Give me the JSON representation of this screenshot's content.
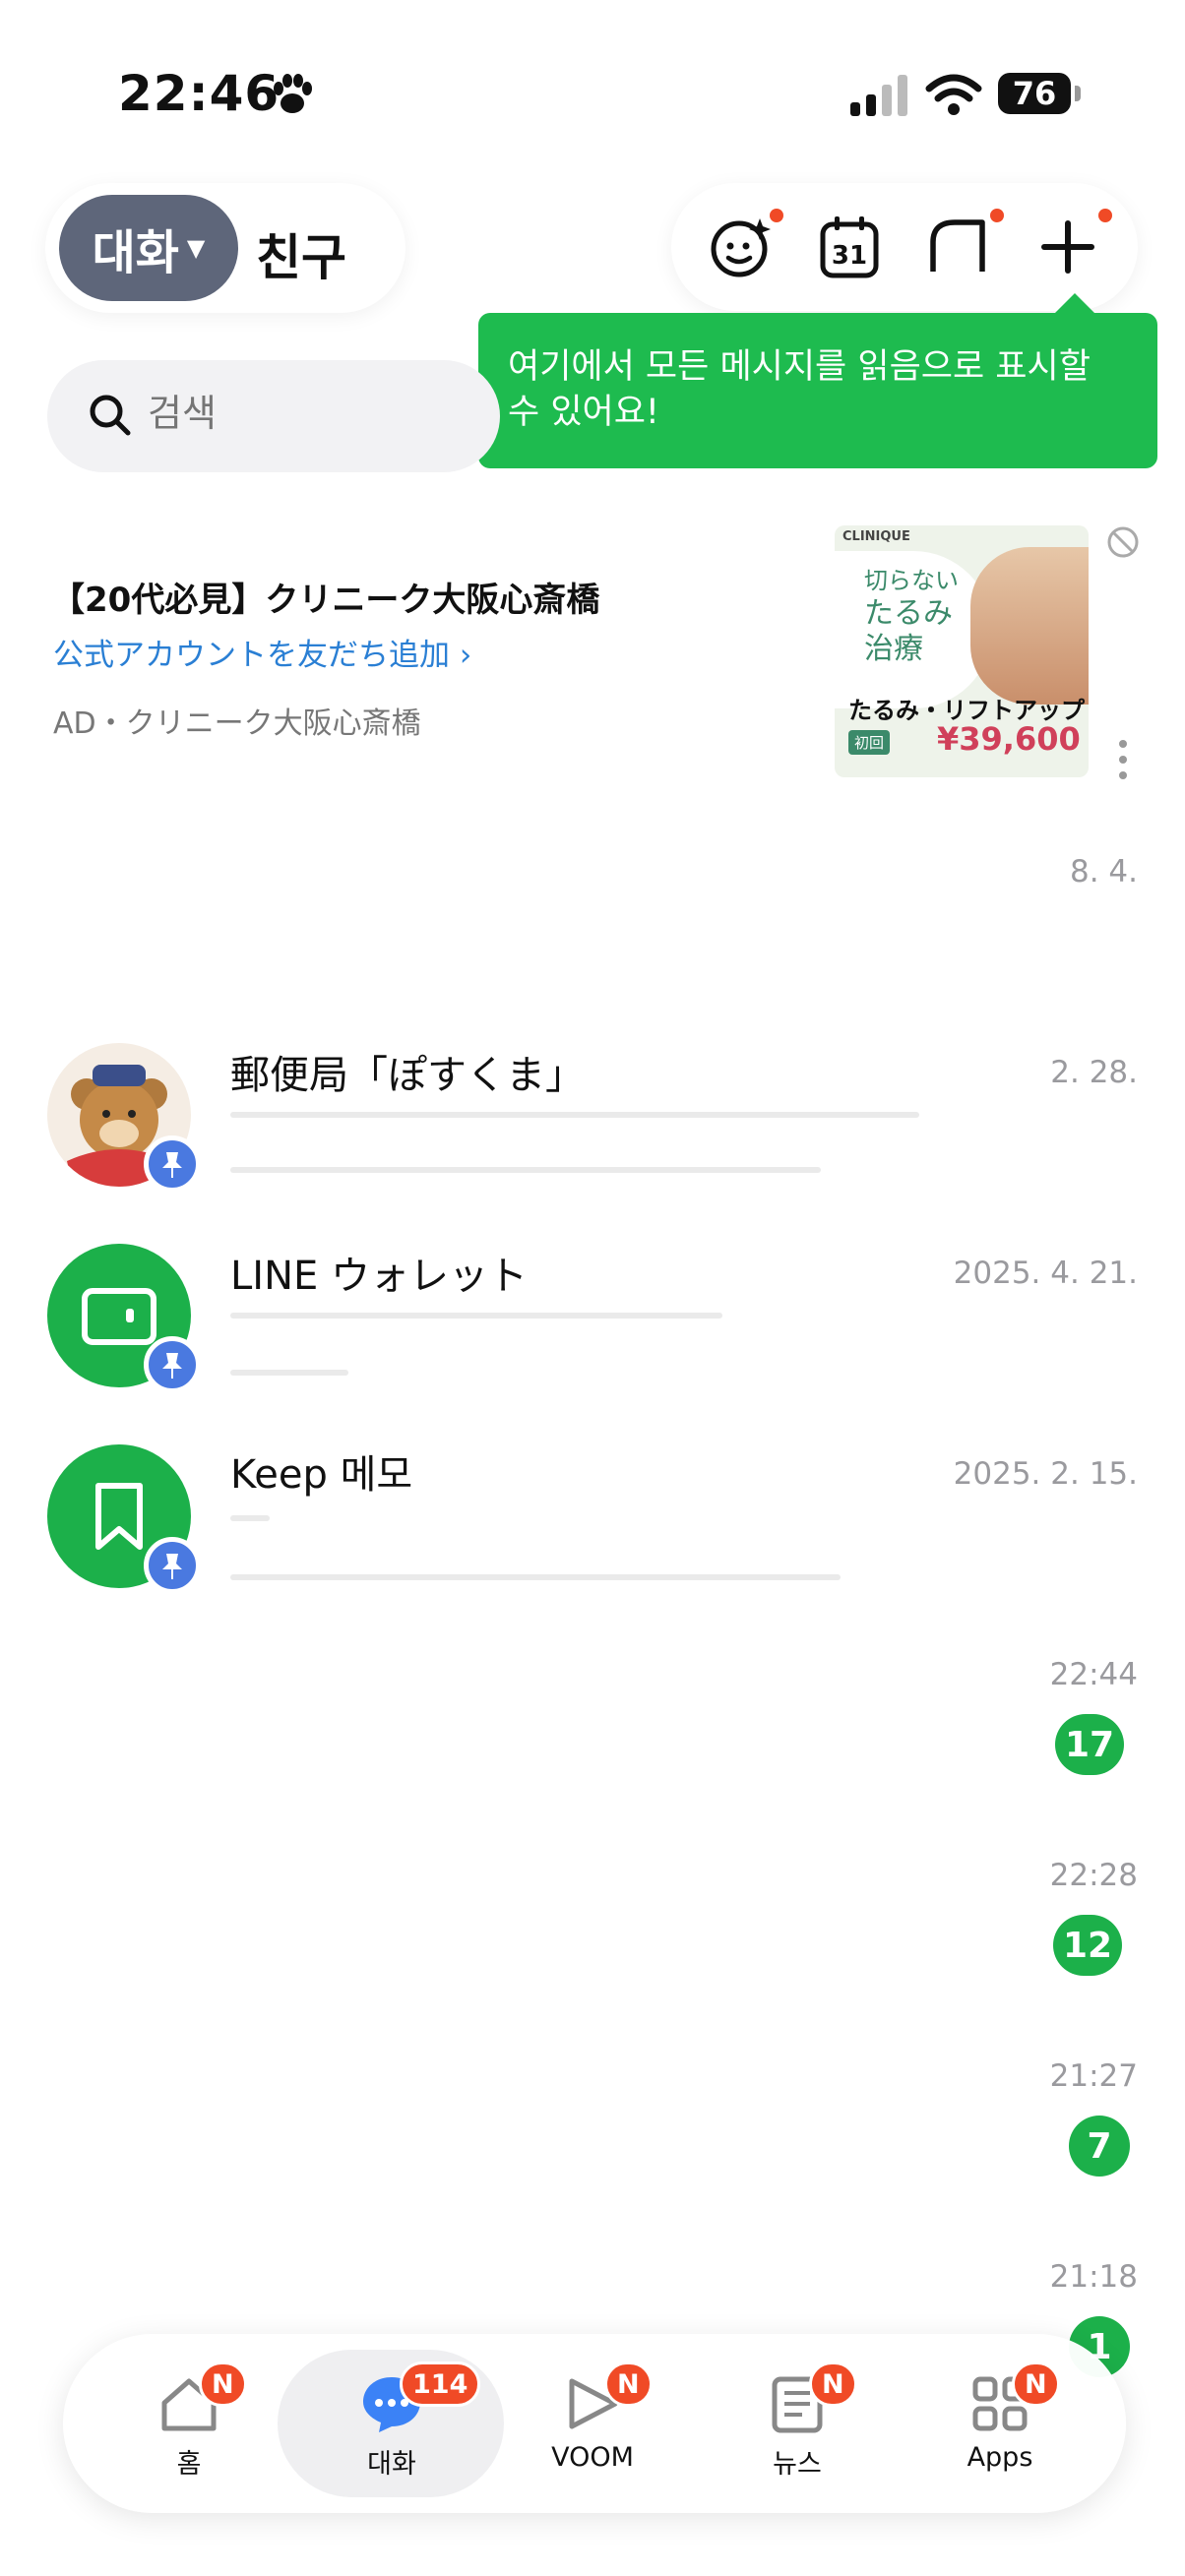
{
  "status": {
    "time": "22:46",
    "battery": "76"
  },
  "header": {
    "tab_chats": "대화",
    "tab_friends": "친구"
  },
  "tooltip": {
    "line1": "여기에서 모든 메시지를 읽음으로 표시할",
    "line2": "수 있어요!"
  },
  "search": {
    "placeholder": "검색"
  },
  "ad": {
    "title": "【20代必見】クリニーク大阪心斎橋",
    "link": "公式アカウントを友だち追加 ›",
    "sponsor": "AD・クリニーク大阪心斎橋",
    "image": {
      "brand": "CLINIQUE",
      "line1": "切らない",
      "line2": "たるみ",
      "line3": "治療",
      "headline": "たるみ・リフトアップ",
      "tag": "初回",
      "price": "¥39,600"
    }
  },
  "chats": [
    {
      "name": "",
      "time": "8. 4.",
      "pinned": false
    },
    {
      "name": "郵便局「ぽすくま」",
      "time": "2. 28.",
      "pinned": true
    },
    {
      "name": "LINE ウォレット",
      "time": "2025. 4. 21.",
      "pinned": true
    },
    {
      "name": "Keep 메모",
      "time": "2025. 2. 15.",
      "pinned": true
    },
    {
      "name": "",
      "time": "22:44",
      "unread": "17"
    },
    {
      "name": "",
      "time": "22:28",
      "unread": "12"
    },
    {
      "name": "",
      "time": "21:27",
      "unread": "7"
    },
    {
      "name": "",
      "time": "21:18",
      "unread": "1"
    }
  ],
  "nav": {
    "items": [
      {
        "label": "홈",
        "badge": "N"
      },
      {
        "label": "대화",
        "badge": "114"
      },
      {
        "label": "VOOM",
        "badge": "N"
      },
      {
        "label": "뉴스",
        "badge": "N"
      },
      {
        "label": "Apps",
        "badge": "N"
      }
    ]
  },
  "colors": {
    "line_green": "#1cb04a",
    "badge_red": "#f04a26",
    "pin_blue": "#4a79e0",
    "segment_active": "#5e667a"
  }
}
